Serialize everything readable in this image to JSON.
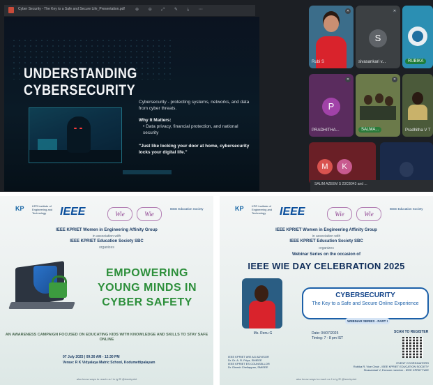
{
  "screen_share": {
    "pdf_title": "Cyber Security - The Key to a Safe and Secure Life_Presentation.pdf",
    "toolbar_icons": "⊕ ⊖ ⤢ ✎ ⤓ ⋯",
    "slide": {
      "title": "UNDERSTANDING CYBERSECURITY",
      "definition": "Cybersecurity - protecting systems, networks, and data from cyber threats.",
      "why_heading": "Why It Matters:",
      "why_points": [
        "Data privacy, financial protection, and national security"
      ],
      "quote": "\"Just like locking your door at home, cybersecurity locks your digital life.\""
    }
  },
  "participants": [
    {
      "name": "Rubi S",
      "type": "video",
      "bg": "#3b6d8a"
    },
    {
      "name": "sivasankari v...",
      "type": "avatar",
      "initial": "S",
      "color": "#5f6368",
      "bg": "#3c4043"
    },
    {
      "name": "RUBIKA",
      "type": "video",
      "bg": "#2b8fb3"
    },
    {
      "name": "PRADHITHA...",
      "type": "avatar",
      "initial": "P",
      "color": "#a142a8",
      "bg": "#5a2c5e"
    },
    {
      "name": "SALMA...",
      "type": "video",
      "bg": "#6b7a4a"
    },
    {
      "name": "Pradhitha V T",
      "type": "video",
      "bg": "#4b5a3a"
    },
    {
      "name": "M",
      "type": "avatar",
      "initial": "M",
      "color": "#d9534f",
      "bg": "#6a1f26"
    },
    {
      "name": "K",
      "type": "avatar",
      "initial": "K",
      "color": "#c85a8f",
      "bg": "#6a1f26"
    },
    {
      "name": "",
      "type": "video",
      "bg": "#1a2a4a"
    }
  ],
  "notification": "SALIM AZEEM S 23CB043 and ...",
  "poster1": {
    "kp_logo": "KPR Institute of Engineering and Technology",
    "ieee": "IEEE",
    "wie1": "Wie",
    "wie2": "Wie",
    "edu_society": "IEEE Education Society",
    "org_line": "IEEE KPRIET Women in Engineering Affinity Group",
    "assoc": "in association with",
    "org_line2": "IEEE KPRIET Education Society SBC",
    "organizes": "organizes",
    "title_lines": [
      "EMPOWERING",
      "YOUNG MINDS IN",
      "CYBER SAFETY"
    ],
    "campaign": "AN AWARENESS CAMPAIGN FOCUSED ON EDUCATING KIDS WITH KNOWLEDGE AND SKILLS TO STAY SAFE ONLINE",
    "date": "07 July 2025 | 09:30 AM - 12:30 PM",
    "venue": "Venue: R K Vidyalaya Matric School, Kodumettipalayam",
    "footer": "also know ways to reach us   f  in  ig  ✉  @ieeekpriet"
  },
  "poster2": {
    "kp_logo": "KPR Institute of Engineering and Technology",
    "ieee": "IEEE",
    "wie1": "Wie",
    "wie2": "Wie",
    "edu_society": "IEEE Education Society",
    "org_line": "IEEE KPRIET Women in Engineering Affinity Group",
    "assoc": "in association with",
    "org_line2": "IEEE KPRIET Education Society SBC",
    "organizes": "organizes",
    "series_line": "Webinar Series on the occasion of",
    "title": "IEEE WIE DAY CELEBRATION 2025",
    "box_title": "CYBERSECURITY",
    "box_subtitle": "The Key to a Safe and Secure Online Experience",
    "webinar_series": "WEBINAR SERIES - PART I",
    "speaker_name": "Ms. Renu G",
    "date": "Date: 04/07/2025",
    "time": "Timing: 7 - 8 pm IST",
    "scan": "SCAN TO REGISTER",
    "advisor": "IEEE KPRIET WIE AG ADVISOR\nDr. Dr. A. R. Priya, SMIEEE\nIEEE KPRIET ES COUNSELLOR\nDr. Dinesh Chellappan, SMIEEE",
    "coordinators": "EVENT COORDINATORS\nRubika R, Vice Chair - IEEE KPRIET EDUCATION SOCIETY\nSivasankari V, Execom member - IEEE KPRIET WIE",
    "footer": "also know ways to reach us   f  in  ig  ✉  @ieeekpriet"
  }
}
